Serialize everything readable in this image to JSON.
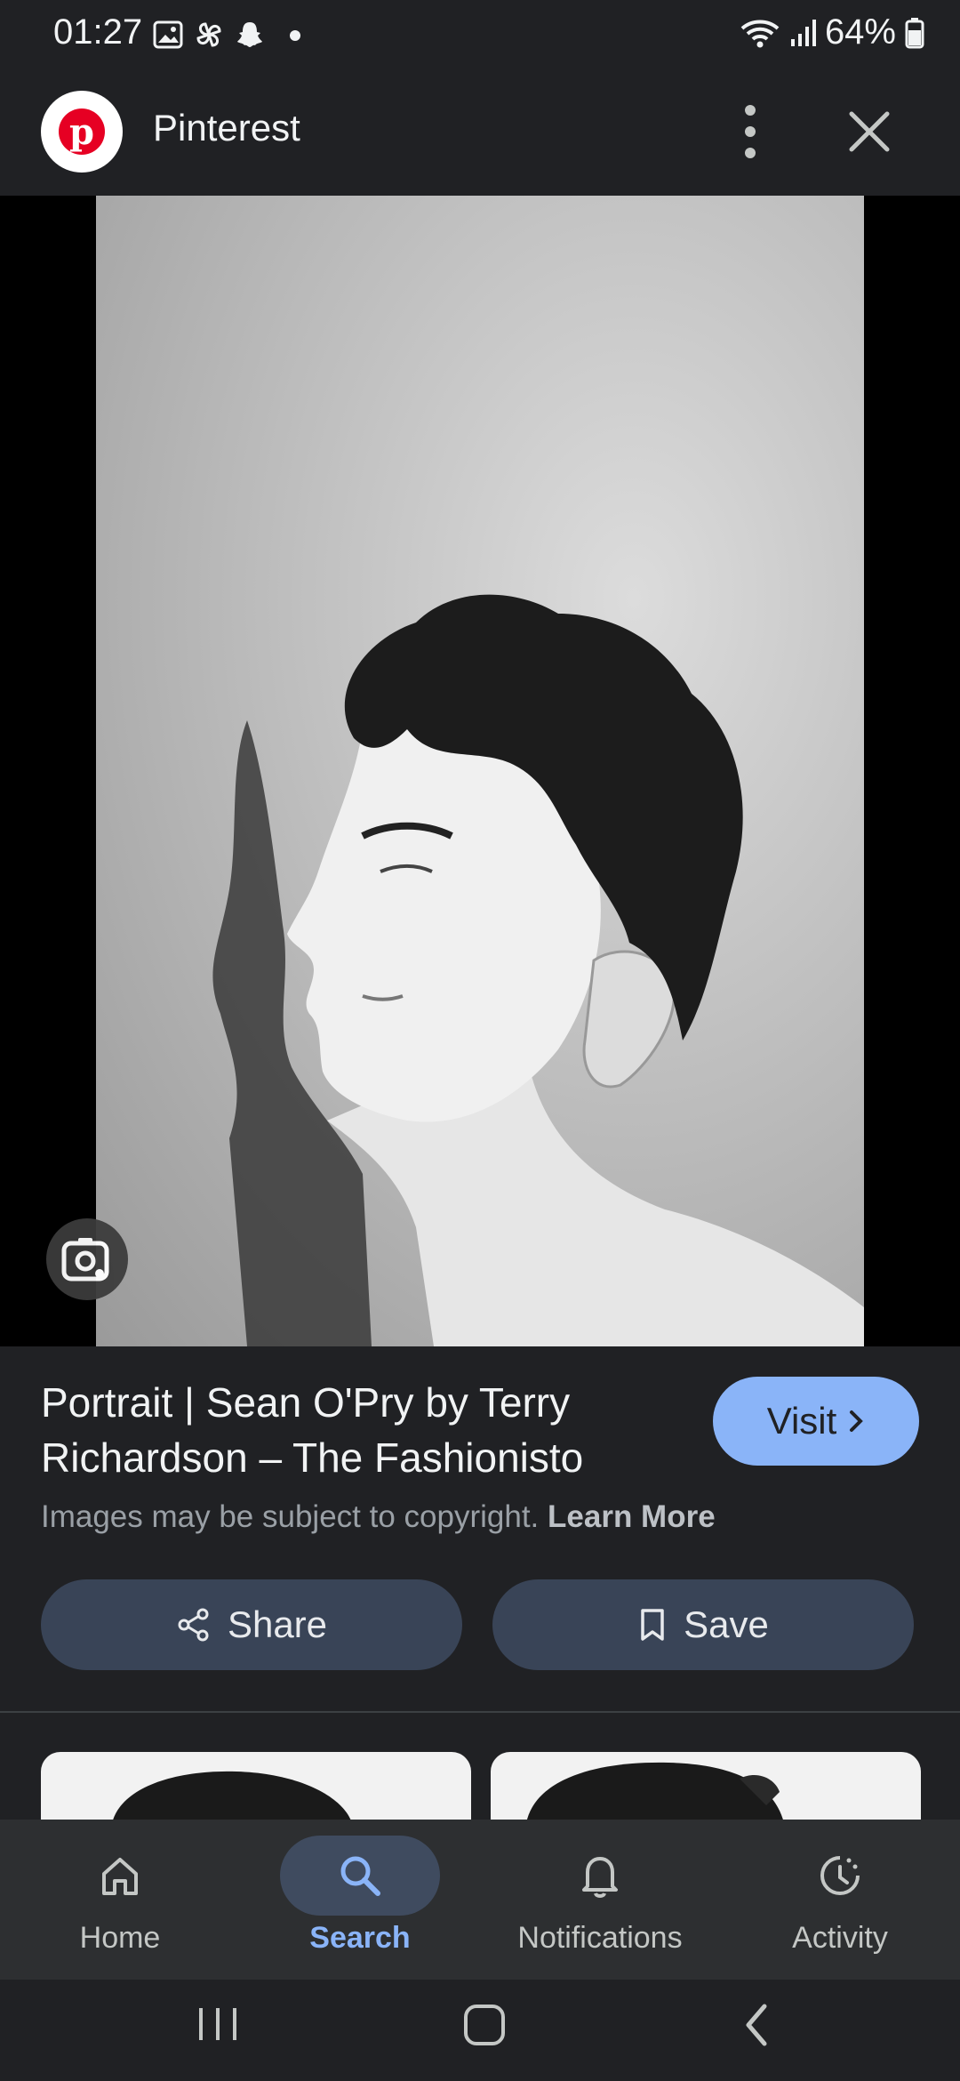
{
  "status_bar": {
    "time": "01:27",
    "left_icons": [
      "gallery-icon",
      "pinwheel-icon",
      "snapchat-icon",
      "dot-icon"
    ],
    "right_icons": [
      "wifi-icon",
      "signal-icon",
      "battery-icon"
    ],
    "battery": "64%"
  },
  "header": {
    "site_name": "Pinterest",
    "logo_letter": "p",
    "menu_icon": "more-vert-icon",
    "close_icon": "close-icon"
  },
  "preview": {
    "lens_icon": "google-lens-icon"
  },
  "result": {
    "title": "Portrait | Sean O'Pry by Terry Richardson – The Fashionisto",
    "visit_label": "Visit",
    "copyright_text": "Images may be subject to copyright.",
    "learn_more": "Learn More",
    "share_label": "Share",
    "save_label": "Save"
  },
  "bottom_nav": {
    "items": [
      {
        "label": "Home",
        "icon": "home-icon"
      },
      {
        "label": "Search",
        "icon": "search-icon",
        "active": true
      },
      {
        "label": "Notifications",
        "icon": "bell-icon"
      },
      {
        "label": "Activity",
        "icon": "activity-icon"
      }
    ]
  },
  "colors": {
    "background": "#202124",
    "accent": "#8ab4f8",
    "button_bg": "#394457",
    "pinterest_red": "#e60023"
  }
}
